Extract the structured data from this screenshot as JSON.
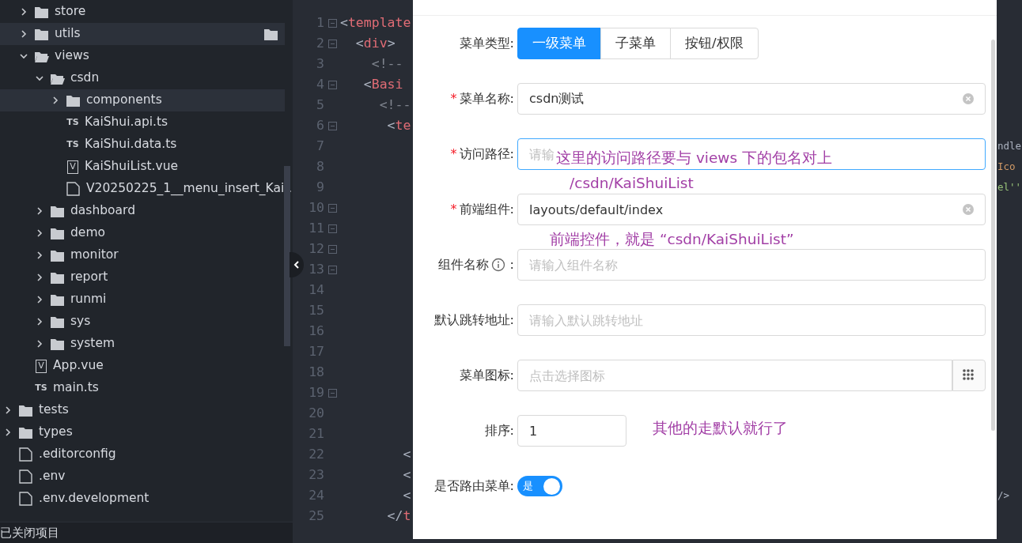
{
  "tree": [
    {
      "kind": "offscreen",
      "children": [
        {
          "kind": "folder",
          "name": "store",
          "expanded": false,
          "highlighted": false
        },
        {
          "kind": "folder",
          "name": "utils",
          "expanded": false,
          "highlighted": true
        },
        {
          "kind": "folder",
          "name": "views",
          "expanded": true,
          "highlighted": false,
          "children": [
            {
              "kind": "folder",
              "name": "csdn",
              "expanded": true,
              "highlighted": false,
              "children": [
                {
                  "kind": "folder",
                  "name": "components",
                  "expanded": false,
                  "highlighted": true
                },
                {
                  "kind": "badge",
                  "badge": "TS",
                  "name": "KaiShui.api.ts"
                },
                {
                  "kind": "badge",
                  "badge": "TS",
                  "name": "KaiShui.data.ts"
                },
                {
                  "kind": "vue",
                  "badge": "V",
                  "name": "KaiShuiList.vue"
                },
                {
                  "kind": "file",
                  "name": "V20250225_1__menu_insert_Kai..."
                }
              ]
            },
            {
              "kind": "folder",
              "name": "dashboard",
              "expanded": false,
              "highlighted": false
            },
            {
              "kind": "folder",
              "name": "demo",
              "expanded": false,
              "highlighted": false
            },
            {
              "kind": "folder",
              "name": "monitor",
              "expanded": false,
              "highlighted": false
            },
            {
              "kind": "folder",
              "name": "report",
              "expanded": false,
              "highlighted": false
            },
            {
              "kind": "folder",
              "name": "runmi",
              "expanded": false,
              "highlighted": false
            },
            {
              "kind": "folder",
              "name": "sys",
              "expanded": false,
              "highlighted": false
            },
            {
              "kind": "folder",
              "name": "system",
              "expanded": false,
              "highlighted": false
            }
          ]
        },
        {
          "kind": "vue",
          "badge": "V",
          "name": "App.vue"
        },
        {
          "kind": "badge",
          "badge": "TS",
          "name": "main.ts"
        }
      ]
    },
    {
      "kind": "folder",
      "name": "tests",
      "expanded": false,
      "highlighted": false
    },
    {
      "kind": "folder",
      "name": "types",
      "expanded": false,
      "highlighted": false
    },
    {
      "kind": "file",
      "name": ".editorconfig"
    },
    {
      "kind": "file",
      "name": ".env"
    },
    {
      "kind": "file",
      "name": ".env.development"
    }
  ],
  "status_bar": "已关闭项目",
  "code_lines": [
    {
      "number": "1",
      "fold": true,
      "tokens": [
        {
          "text": "<",
          "kind": "punct"
        },
        {
          "text": "template",
          "kind": "tag"
        }
      ]
    },
    {
      "number": "2",
      "fold": true,
      "tokens": [
        {
          "text": "  <",
          "kind": "punct"
        },
        {
          "text": "div",
          "kind": "tag"
        },
        {
          "text": ">",
          "kind": "punct"
        }
      ]
    },
    {
      "number": "3",
      "fold": false,
      "tokens": [
        {
          "text": "    <!--",
          "kind": "comment"
        }
      ]
    },
    {
      "number": "4",
      "fold": true,
      "tokens": [
        {
          "text": "   <",
          "kind": "punct"
        },
        {
          "text": "Basi",
          "kind": "tag"
        }
      ]
    },
    {
      "number": "5",
      "fold": false,
      "tokens": [
        {
          "text": "     <!--",
          "kind": "comment"
        }
      ]
    },
    {
      "number": "6",
      "fold": true,
      "tokens": [
        {
          "text": "      <",
          "kind": "punct"
        },
        {
          "text": "te",
          "kind": "tag"
        }
      ]
    },
    {
      "number": "7",
      "fold": false,
      "right": [
        {
          "text": "ndle",
          "kind": "plain"
        }
      ]
    },
    {
      "number": "8",
      "fold": false,
      "right": [
        {
          "text": "Ico",
          "kind": "attr"
        }
      ]
    },
    {
      "number": "9",
      "fold": false,
      "right": [
        {
          "text": "el''",
          "kind": "string"
        }
      ]
    },
    {
      "number": "10",
      "fold": true
    },
    {
      "number": "11",
      "fold": true
    },
    {
      "number": "12",
      "fold": true
    },
    {
      "number": "13",
      "fold": true
    },
    {
      "number": "14",
      "fold": false
    },
    {
      "number": "15",
      "fold": false
    },
    {
      "number": "16",
      "fold": false
    },
    {
      "number": "17",
      "fold": false
    },
    {
      "number": "18",
      "fold": false
    },
    {
      "number": "19",
      "fold": true
    },
    {
      "number": "20",
      "fold": false
    },
    {
      "number": "21",
      "fold": false
    },
    {
      "number": "22",
      "fold": false,
      "tokens": [
        {
          "text": "        <",
          "kind": "punct"
        }
      ]
    },
    {
      "number": "23",
      "fold": false,
      "tokens": [
        {
          "text": "        <",
          "kind": "punct"
        }
      ]
    },
    {
      "number": "24",
      "fold": false,
      "tokens": [
        {
          "text": "        <",
          "kind": "punct"
        }
      ],
      "right": [
        {
          "text": "/>",
          "kind": "punct"
        }
      ]
    },
    {
      "number": "25",
      "fold": false,
      "tokens": [
        {
          "text": "      </",
          "kind": "punct"
        },
        {
          "text": "t",
          "kind": "tag"
        }
      ]
    }
  ],
  "form": {
    "rows": [
      {
        "kind": "segmented",
        "label": "菜单类型:",
        "options": [
          {
            "label": "一级菜单",
            "selected": true
          },
          {
            "label": "子菜单",
            "selected": false
          },
          {
            "label": "按钮/权限",
            "selected": false
          }
        ]
      },
      {
        "kind": "input",
        "required_mark": "*",
        "label": "菜单名称:",
        "value": "csdn测试",
        "clearable": true,
        "focused": false
      },
      {
        "kind": "input",
        "required_mark": "*",
        "label": "访问路径:",
        "placeholder": "请输",
        "clearable": false,
        "focused": true
      },
      {
        "kind": "input",
        "required_mark": "*",
        "label": "前端组件:",
        "value": "layouts/default/index",
        "clearable": true,
        "focused": false
      },
      {
        "kind": "input",
        "label": "组件名称",
        "info": true,
        "label_suffix": ":",
        "placeholder": "请输入组件名称",
        "clearable": false,
        "focused": false
      },
      {
        "kind": "input",
        "label": "默认跳转地址:",
        "placeholder": "请输入默认跳转地址",
        "clearable": false,
        "focused": false
      },
      {
        "kind": "icon-picker",
        "label": "菜单图标:",
        "placeholder": "点击选择图标"
      },
      {
        "kind": "number",
        "label": "排序:",
        "value": "1"
      },
      {
        "kind": "switch",
        "label": "是否路由菜单:",
        "on": true,
        "text": "是"
      }
    ]
  },
  "annotations": [
    {
      "text": "这里的访问路径要与 views 下的包名对上"
    },
    {
      "text": "/csdn/KaiShuiList"
    },
    {
      "text": "前端控件，就是 “csdn/KaiShuiList”"
    },
    {
      "text": "其他的走默认就行了"
    }
  ]
}
